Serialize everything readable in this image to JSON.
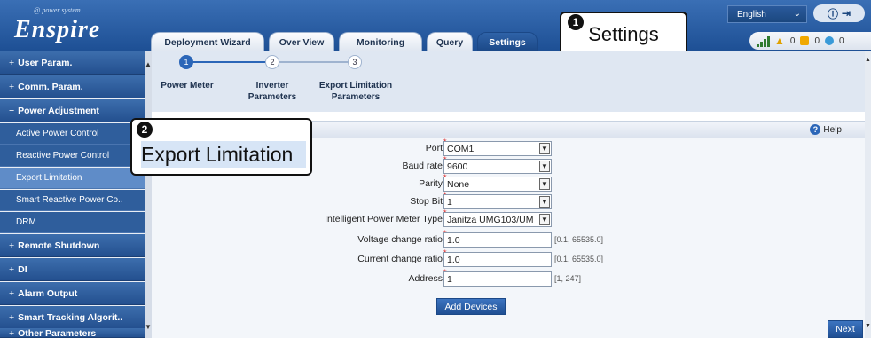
{
  "header": {
    "logo_tag": "@ power system",
    "logo_word": "Enspire",
    "tabs": [
      "Deployment Wizard",
      "Over View",
      "Monitoring",
      "Query",
      "Settings"
    ],
    "active_tab": "Settings",
    "language": "English",
    "alarms": {
      "critical": "0",
      "major": "0",
      "minor": "0"
    }
  },
  "callouts": {
    "c1_number": "1",
    "c1_text": "Settings",
    "c2_number": "2",
    "c2_text": "Export Limitation"
  },
  "sidebar": {
    "items": [
      {
        "label": "User Param.",
        "marker": "+"
      },
      {
        "label": "Comm. Param.",
        "marker": "+"
      },
      {
        "label": "Power Adjustment",
        "marker": "−"
      }
    ],
    "sub_items": [
      "Active Power Control",
      "Reactive Power Control",
      "Export Limitation",
      "Smart Reactive Power Co..",
      "DRM"
    ],
    "more_items": [
      {
        "label": "Remote Shutdown",
        "marker": "+"
      },
      {
        "label": "DI",
        "marker": "+"
      },
      {
        "label": "Alarm Output",
        "marker": "+"
      },
      {
        "label": "Smart Tracking Algorit..",
        "marker": "+"
      },
      {
        "label": "Other Parameters",
        "marker": "+"
      }
    ]
  },
  "steps": [
    {
      "number": "1",
      "label": "Power Meter"
    },
    {
      "number": "2",
      "label": "Inverter Parameters"
    },
    {
      "number": "3",
      "label": "Export Limitation Parameters"
    }
  ],
  "panel": {
    "help_label": "Help"
  },
  "form": {
    "port": {
      "label": "Port",
      "value": "COM1"
    },
    "baud": {
      "label": "Baud rate",
      "value": "9600"
    },
    "parity": {
      "label": "Parity",
      "value": "None"
    },
    "stop": {
      "label": "Stop Bit",
      "value": "1"
    },
    "meter": {
      "label": "Intelligent Power Meter Type",
      "value": "Janitza UMG103/UM"
    },
    "voltage": {
      "label": "Voltage change ratio",
      "value": "1.0",
      "range": "[0.1, 65535.0]"
    },
    "current": {
      "label": "Current change ratio",
      "value": "1.0",
      "range": "[0.1, 65535.0]"
    },
    "address": {
      "label": "Address",
      "value": "1",
      "range": "[1, 247]"
    }
  },
  "buttons": {
    "add_devices": "Add Devices",
    "next": "Next"
  }
}
